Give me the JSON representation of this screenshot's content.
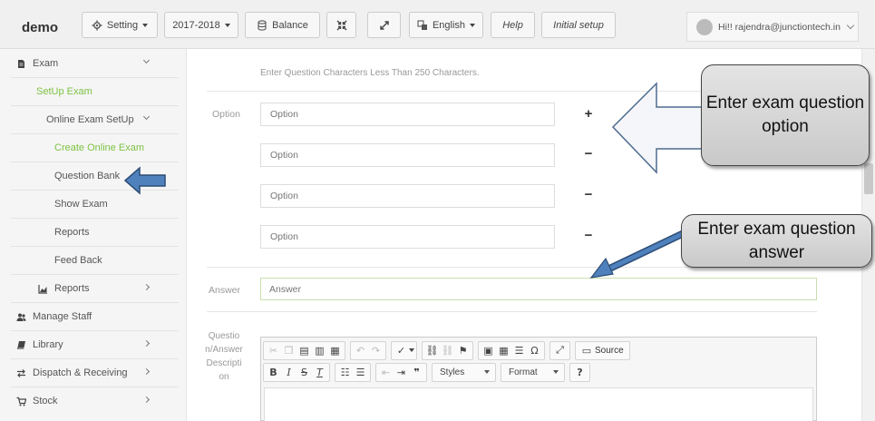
{
  "header": {
    "brand": "demo",
    "setting_label": "Setting",
    "year_label": "2017-2018",
    "balance_label": "Balance",
    "language_label": "English",
    "help_label": "Help",
    "initial_setup_label": "Initial setup",
    "user_label": "Hi!! rajendra@junctiontech.in"
  },
  "sidebar": {
    "items": [
      {
        "label": "Exam",
        "icon": "file-icon"
      },
      {
        "label": "SetUp Exam"
      },
      {
        "label": "Online Exam SetUp"
      },
      {
        "label": "Create Online Exam"
      },
      {
        "label": "Question Bank"
      },
      {
        "label": "Show Exam"
      },
      {
        "label": "Reports"
      },
      {
        "label": "Feed Back"
      },
      {
        "label": "Reports",
        "icon": "chart-icon"
      },
      {
        "label": "Manage Staff",
        "icon": "users-icon"
      },
      {
        "label": "Library",
        "icon": "book-icon"
      },
      {
        "label": "Dispatch & Receiving",
        "icon": "exchange-icon"
      },
      {
        "label": "Stock",
        "icon": "cart-icon"
      }
    ],
    "active_color": "#7dc242"
  },
  "form": {
    "hint": "Enter Question Characters Less Than 250 Characters.",
    "option_label": "Option",
    "option_placeholder": "Option",
    "add_symbol": "+",
    "remove_symbol": "−",
    "answer_label": "Answer",
    "answer_placeholder": "Answer",
    "description_label": "Question/Answer Description"
  },
  "editor": {
    "source_label": "Source",
    "styles_label": "Styles",
    "format_label": "Format",
    "help_symbol": "?"
  },
  "annotations": {
    "callout_option": "Enter exam question option",
    "callout_answer": "Enter exam question answer"
  }
}
